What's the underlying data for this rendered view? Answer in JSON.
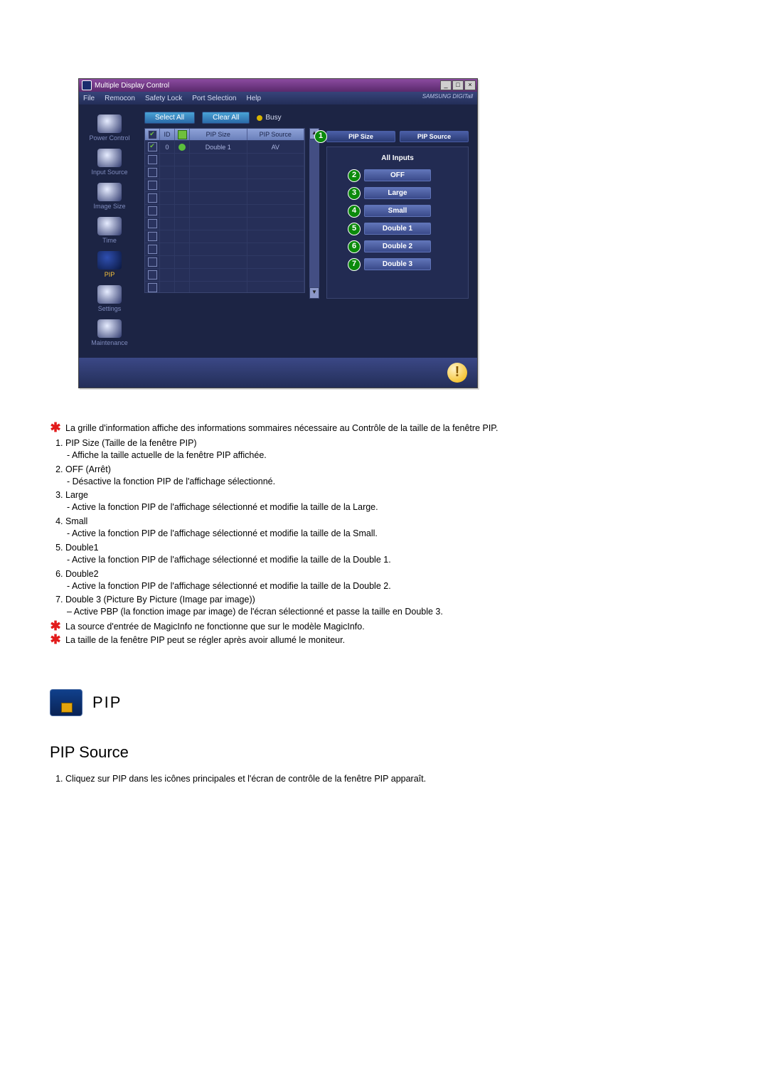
{
  "app": {
    "title": "Multiple Display Control",
    "brand": "SAMSUNG DIGITall",
    "window_buttons": {
      "min": "_",
      "max": "□",
      "close": "×"
    },
    "menu": [
      "File",
      "Remocon",
      "Safety Lock",
      "Port Selection",
      "Help"
    ]
  },
  "sidebar": {
    "items": [
      {
        "label": "Power Control"
      },
      {
        "label": "Input Source"
      },
      {
        "label": "Image Size"
      },
      {
        "label": "Time"
      },
      {
        "label": "PIP"
      },
      {
        "label": "Settings"
      },
      {
        "label": "Maintenance"
      }
    ],
    "active_index": 4
  },
  "toolbar": {
    "select_all": "Select All",
    "clear_all": "Clear All",
    "busy": "Busy"
  },
  "grid": {
    "headers": {
      "chk": "✔",
      "id": "ID",
      "status": "●",
      "pip_size": "PIP Size",
      "pip_source": "PIP Source"
    },
    "row0": {
      "id": "0",
      "pip_size": "Double 1",
      "pip_source": "AV"
    },
    "blank_rows": 10
  },
  "panel": {
    "top": {
      "pip_size": "PIP Size",
      "pip_source": "PIP Source"
    },
    "section_title": "All Inputs",
    "options": [
      {
        "num": "2",
        "label": "OFF"
      },
      {
        "num": "3",
        "label": "Large"
      },
      {
        "num": "4",
        "label": "Small"
      },
      {
        "num": "5",
        "label": "Double 1"
      },
      {
        "num": "6",
        "label": "Double 2"
      },
      {
        "num": "7",
        "label": "Double 3"
      }
    ],
    "callout_top_num": "1"
  },
  "doc": {
    "star1": "La grille d'information affiche des informations sommaires nécessaire au Contrôle de la taille de la fenêtre PIP.",
    "items": [
      {
        "head": "PIP Size (Taille de la fenêtre PIP)",
        "body": "- Affiche la taille actuelle de la fenêtre PIP affichée."
      },
      {
        "head": "OFF (Arrêt)",
        "body": "- Désactive la fonction PIP de l'affichage sélectionné."
      },
      {
        "head": "Large",
        "body": "- Active la fonction PIP de l'affichage sélectionné et modifie la taille de la Large."
      },
      {
        "head": "Small",
        "body": "- Active la fonction PIP de l'affichage sélectionné et modifie la taille de la Small."
      },
      {
        "head": "Double1",
        "body": "- Active la fonction PIP de l'affichage sélectionné et modifie la taille de la Double 1."
      },
      {
        "head": "Double2",
        "body": "- Active la fonction PIP de l'affichage sélectionné et modifie la taille de la Double 2."
      },
      {
        "head": "Double 3 (Picture By Picture (Image par image))",
        "body": "– Active PBP (la fonction image par image) de l'écran sélectionné et passe la taille en Double 3."
      }
    ],
    "star2": "La source d'entrée de MagicInfo ne fonctionne que sur le modèle MagicInfo.",
    "star3": "La taille de la fenêtre PIP peut se régler après avoir allumé le moniteur.",
    "section_label": "PIP",
    "h2": "PIP Source",
    "step1": "Cliquez sur PIP dans les icônes principales et l'écran de contrôle de la fenêtre PIP apparaît."
  }
}
